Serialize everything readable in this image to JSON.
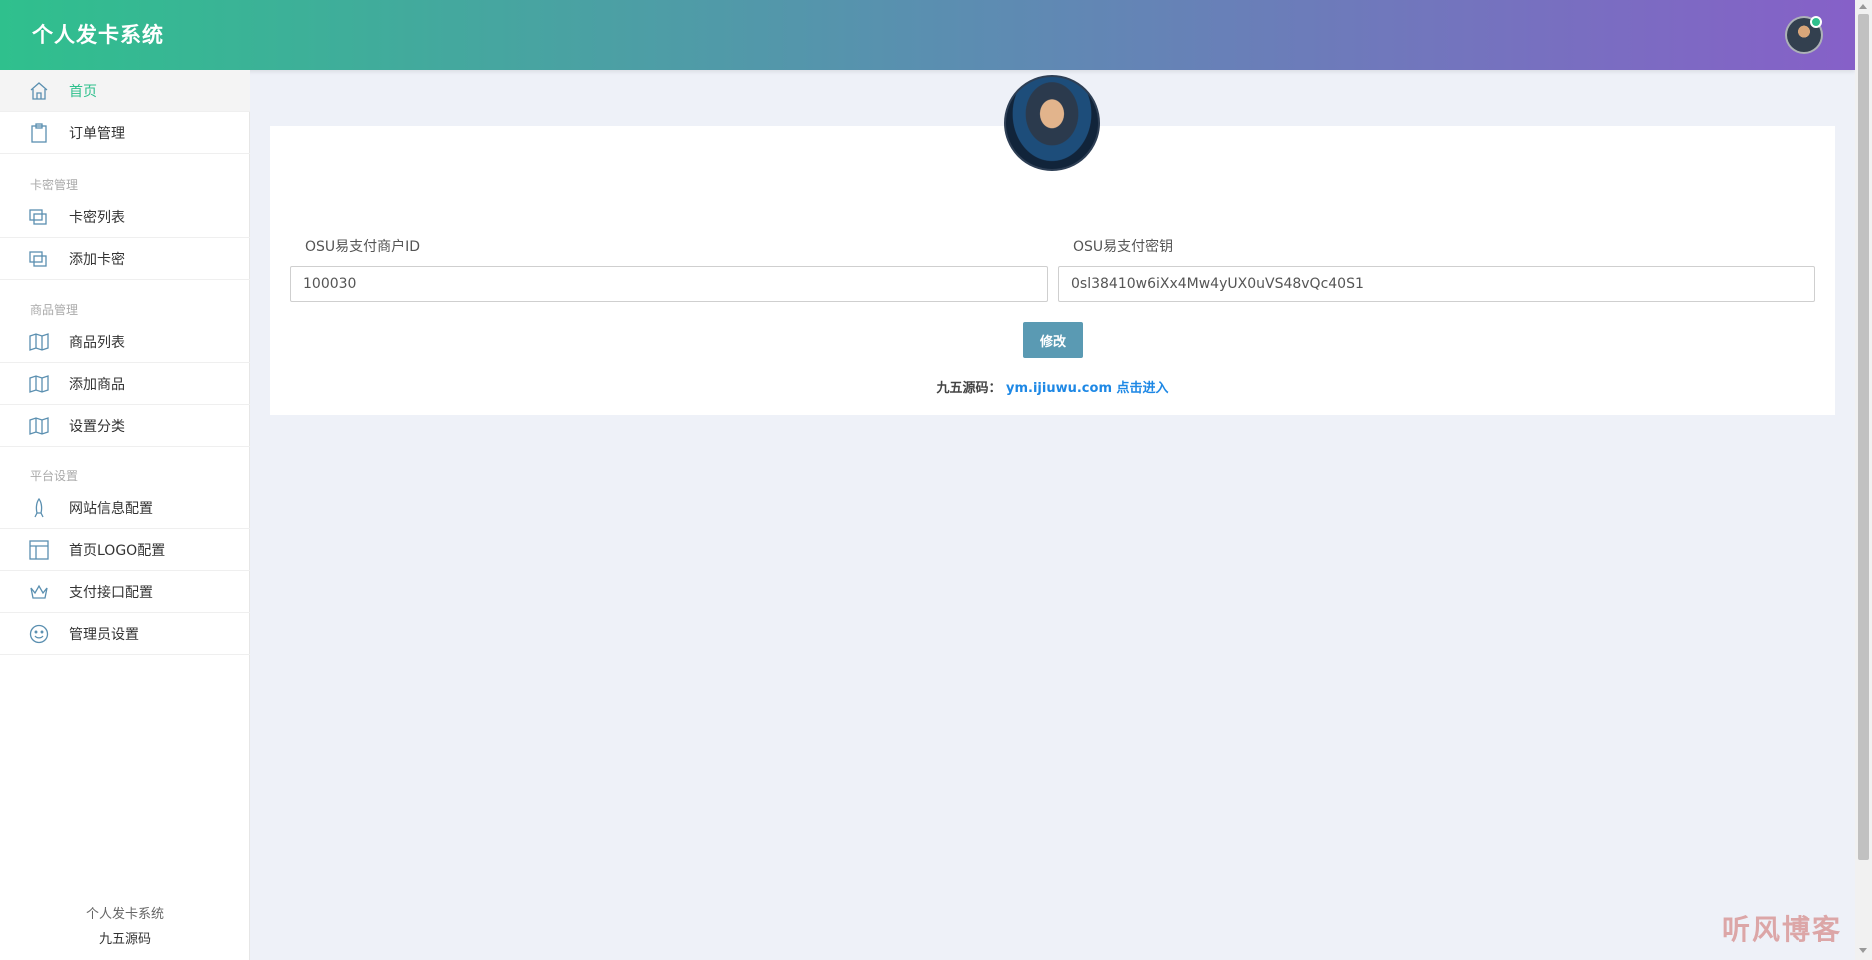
{
  "header": {
    "brand": "个人发卡系统"
  },
  "sidebar": {
    "items": [
      {
        "label": "首页",
        "icon": "home-icon",
        "active": true
      },
      {
        "label": "订单管理",
        "icon": "clipboard-icon"
      }
    ],
    "sections": [
      {
        "title": "卡密管理",
        "items": [
          {
            "label": "卡密列表",
            "icon": "cards-icon"
          },
          {
            "label": "添加卡密",
            "icon": "cards-icon"
          }
        ]
      },
      {
        "title": "商品管理",
        "items": [
          {
            "label": "商品列表",
            "icon": "map-icon"
          },
          {
            "label": "添加商品",
            "icon": "map-icon"
          },
          {
            "label": "设置分类",
            "icon": "map-icon"
          }
        ]
      },
      {
        "title": "平台设置",
        "items": [
          {
            "label": "网站信息配置",
            "icon": "rocket-icon"
          },
          {
            "label": "首页LOGO配置",
            "icon": "layout-icon"
          },
          {
            "label": "支付接口配置",
            "icon": "crown-icon"
          },
          {
            "label": "管理员设置",
            "icon": "smile-icon"
          }
        ]
      }
    ],
    "footer": {
      "line1": "个人发卡系统",
      "line2": "九五源码"
    }
  },
  "form": {
    "merchant_id_label": "OSU易支付商户ID",
    "merchant_id_value": "100030",
    "secret_label": "OSU易支付密钥",
    "secret_value": "0sl38410w6iXx4Mw4yUX0uVS48vQc40S1",
    "submit_label": "修改"
  },
  "footer": {
    "label": "九五源码：",
    "link_text": "ym.ijiuwu.com 点击进入"
  },
  "watermark": "听风博客",
  "colors": {
    "accent": "#2fc08d",
    "header_gradient": [
      "#2fc08d",
      "#8660c8"
    ],
    "button": "#5a9ab3",
    "link": "#1e88e5"
  }
}
